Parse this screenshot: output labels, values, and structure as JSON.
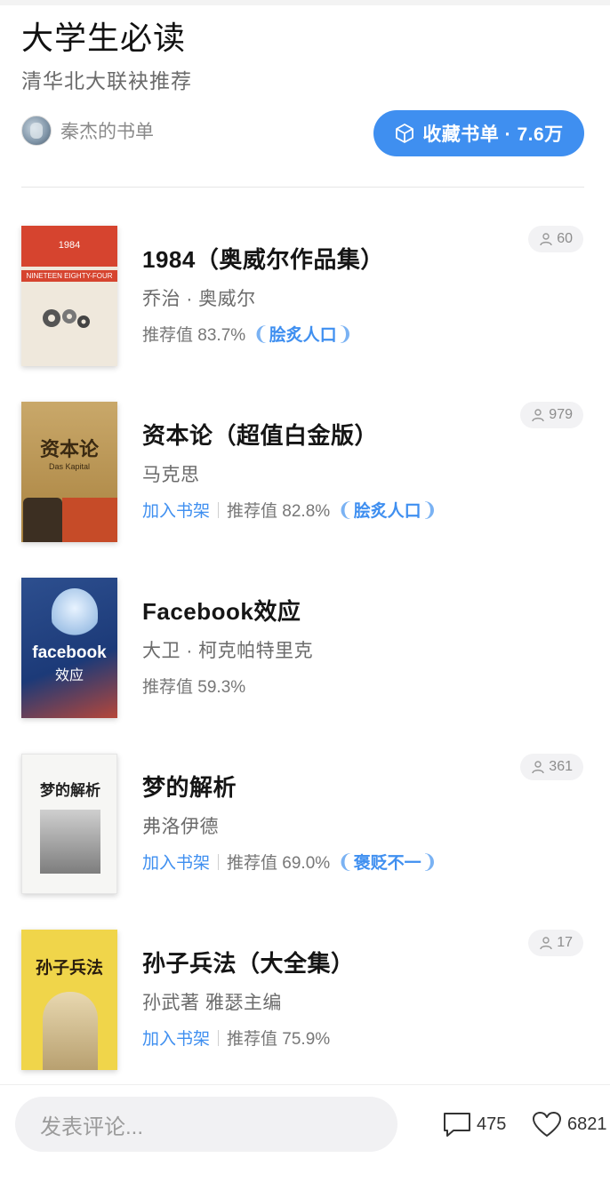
{
  "header": {
    "title": "大学生必读",
    "subtitle": "清华北大联袂推荐",
    "author": "秦杰的书单",
    "favorite_label": "收藏书单 · 7.6万"
  },
  "books": [
    {
      "title": "1984（奥威尔作品集）",
      "author": "乔治 · 奥威尔",
      "shelf_label": "",
      "score": "推荐值 83.7%",
      "badge": "脍炙人口",
      "readers": "60",
      "cover_text": [
        "1984",
        "NINETEEN EIGHTY-FOUR"
      ]
    },
    {
      "title": "资本论（超值白金版）",
      "author": "马克思",
      "shelf_label": "加入书架",
      "score": "推荐值 82.8%",
      "badge": "脍炙人口",
      "readers": "979",
      "cover_text": [
        "资本论",
        "Das Kapital"
      ]
    },
    {
      "title": "Facebook效应",
      "author": "大卫 · 柯克帕特里克",
      "shelf_label": "",
      "score": "推荐值 59.3%",
      "badge": "",
      "readers": "",
      "cover_text": [
        "facebook",
        "效应"
      ]
    },
    {
      "title": "梦的解析",
      "author": "弗洛伊德",
      "shelf_label": "加入书架",
      "score": "推荐值 69.0%",
      "badge": "褒贬不一",
      "readers": "361",
      "cover_text": [
        "梦的解析",
        ""
      ]
    },
    {
      "title": "孙子兵法（大全集）",
      "author": "孙武著 雅瑟主编",
      "shelf_label": "加入书架",
      "score": "推荐值 75.9%",
      "badge": "",
      "readers": "17",
      "cover_text": [
        "孙子兵法",
        ""
      ]
    }
  ],
  "footer": {
    "comment_placeholder": "发表评论...",
    "comment_count": "475",
    "like_count": "6821"
  },
  "colors": {
    "accent": "#3f8ff0",
    "muted": "#777777"
  }
}
